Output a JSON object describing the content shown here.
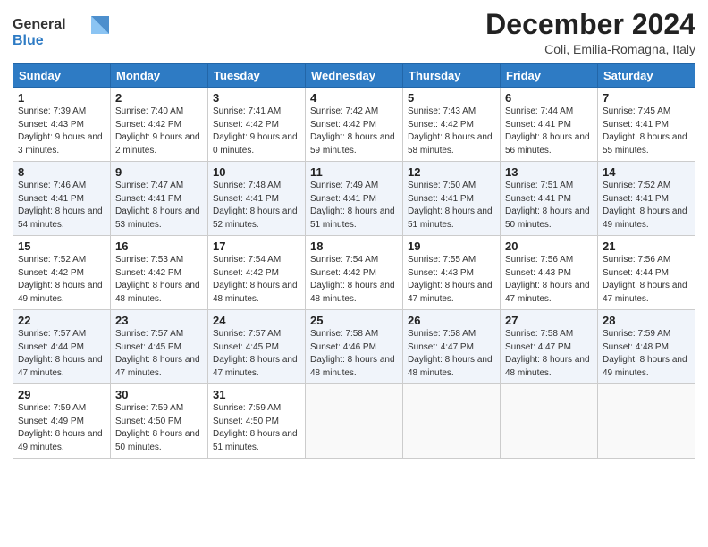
{
  "logo": {
    "line1": "General",
    "line2": "Blue"
  },
  "title": "December 2024",
  "subtitle": "Coli, Emilia-Romagna, Italy",
  "days_header": [
    "Sunday",
    "Monday",
    "Tuesday",
    "Wednesday",
    "Thursday",
    "Friday",
    "Saturday"
  ],
  "weeks": [
    [
      {
        "day": "1",
        "sunrise": "Sunrise: 7:39 AM",
        "sunset": "Sunset: 4:43 PM",
        "daylight": "Daylight: 9 hours and 3 minutes."
      },
      {
        "day": "2",
        "sunrise": "Sunrise: 7:40 AM",
        "sunset": "Sunset: 4:42 PM",
        "daylight": "Daylight: 9 hours and 2 minutes."
      },
      {
        "day": "3",
        "sunrise": "Sunrise: 7:41 AM",
        "sunset": "Sunset: 4:42 PM",
        "daylight": "Daylight: 9 hours and 0 minutes."
      },
      {
        "day": "4",
        "sunrise": "Sunrise: 7:42 AM",
        "sunset": "Sunset: 4:42 PM",
        "daylight": "Daylight: 8 hours and 59 minutes."
      },
      {
        "day": "5",
        "sunrise": "Sunrise: 7:43 AM",
        "sunset": "Sunset: 4:42 PM",
        "daylight": "Daylight: 8 hours and 58 minutes."
      },
      {
        "day": "6",
        "sunrise": "Sunrise: 7:44 AM",
        "sunset": "Sunset: 4:41 PM",
        "daylight": "Daylight: 8 hours and 56 minutes."
      },
      {
        "day": "7",
        "sunrise": "Sunrise: 7:45 AM",
        "sunset": "Sunset: 4:41 PM",
        "daylight": "Daylight: 8 hours and 55 minutes."
      }
    ],
    [
      {
        "day": "8",
        "sunrise": "Sunrise: 7:46 AM",
        "sunset": "Sunset: 4:41 PM",
        "daylight": "Daylight: 8 hours and 54 minutes."
      },
      {
        "day": "9",
        "sunrise": "Sunrise: 7:47 AM",
        "sunset": "Sunset: 4:41 PM",
        "daylight": "Daylight: 8 hours and 53 minutes."
      },
      {
        "day": "10",
        "sunrise": "Sunrise: 7:48 AM",
        "sunset": "Sunset: 4:41 PM",
        "daylight": "Daylight: 8 hours and 52 minutes."
      },
      {
        "day": "11",
        "sunrise": "Sunrise: 7:49 AM",
        "sunset": "Sunset: 4:41 PM",
        "daylight": "Daylight: 8 hours and 51 minutes."
      },
      {
        "day": "12",
        "sunrise": "Sunrise: 7:50 AM",
        "sunset": "Sunset: 4:41 PM",
        "daylight": "Daylight: 8 hours and 51 minutes."
      },
      {
        "day": "13",
        "sunrise": "Sunrise: 7:51 AM",
        "sunset": "Sunset: 4:41 PM",
        "daylight": "Daylight: 8 hours and 50 minutes."
      },
      {
        "day": "14",
        "sunrise": "Sunrise: 7:52 AM",
        "sunset": "Sunset: 4:41 PM",
        "daylight": "Daylight: 8 hours and 49 minutes."
      }
    ],
    [
      {
        "day": "15",
        "sunrise": "Sunrise: 7:52 AM",
        "sunset": "Sunset: 4:42 PM",
        "daylight": "Daylight: 8 hours and 49 minutes."
      },
      {
        "day": "16",
        "sunrise": "Sunrise: 7:53 AM",
        "sunset": "Sunset: 4:42 PM",
        "daylight": "Daylight: 8 hours and 48 minutes."
      },
      {
        "day": "17",
        "sunrise": "Sunrise: 7:54 AM",
        "sunset": "Sunset: 4:42 PM",
        "daylight": "Daylight: 8 hours and 48 minutes."
      },
      {
        "day": "18",
        "sunrise": "Sunrise: 7:54 AM",
        "sunset": "Sunset: 4:42 PM",
        "daylight": "Daylight: 8 hours and 48 minutes."
      },
      {
        "day": "19",
        "sunrise": "Sunrise: 7:55 AM",
        "sunset": "Sunset: 4:43 PM",
        "daylight": "Daylight: 8 hours and 47 minutes."
      },
      {
        "day": "20",
        "sunrise": "Sunrise: 7:56 AM",
        "sunset": "Sunset: 4:43 PM",
        "daylight": "Daylight: 8 hours and 47 minutes."
      },
      {
        "day": "21",
        "sunrise": "Sunrise: 7:56 AM",
        "sunset": "Sunset: 4:44 PM",
        "daylight": "Daylight: 8 hours and 47 minutes."
      }
    ],
    [
      {
        "day": "22",
        "sunrise": "Sunrise: 7:57 AM",
        "sunset": "Sunset: 4:44 PM",
        "daylight": "Daylight: 8 hours and 47 minutes."
      },
      {
        "day": "23",
        "sunrise": "Sunrise: 7:57 AM",
        "sunset": "Sunset: 4:45 PM",
        "daylight": "Daylight: 8 hours and 47 minutes."
      },
      {
        "day": "24",
        "sunrise": "Sunrise: 7:57 AM",
        "sunset": "Sunset: 4:45 PM",
        "daylight": "Daylight: 8 hours and 47 minutes."
      },
      {
        "day": "25",
        "sunrise": "Sunrise: 7:58 AM",
        "sunset": "Sunset: 4:46 PM",
        "daylight": "Daylight: 8 hours and 48 minutes."
      },
      {
        "day": "26",
        "sunrise": "Sunrise: 7:58 AM",
        "sunset": "Sunset: 4:47 PM",
        "daylight": "Daylight: 8 hours and 48 minutes."
      },
      {
        "day": "27",
        "sunrise": "Sunrise: 7:58 AM",
        "sunset": "Sunset: 4:47 PM",
        "daylight": "Daylight: 8 hours and 48 minutes."
      },
      {
        "day": "28",
        "sunrise": "Sunrise: 7:59 AM",
        "sunset": "Sunset: 4:48 PM",
        "daylight": "Daylight: 8 hours and 49 minutes."
      }
    ],
    [
      {
        "day": "29",
        "sunrise": "Sunrise: 7:59 AM",
        "sunset": "Sunset: 4:49 PM",
        "daylight": "Daylight: 8 hours and 49 minutes."
      },
      {
        "day": "30",
        "sunrise": "Sunrise: 7:59 AM",
        "sunset": "Sunset: 4:50 PM",
        "daylight": "Daylight: 8 hours and 50 minutes."
      },
      {
        "day": "31",
        "sunrise": "Sunrise: 7:59 AM",
        "sunset": "Sunset: 4:50 PM",
        "daylight": "Daylight: 8 hours and 51 minutes."
      },
      null,
      null,
      null,
      null
    ]
  ]
}
